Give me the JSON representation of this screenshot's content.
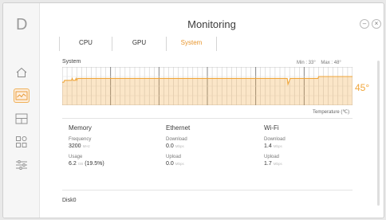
{
  "app": {
    "title": "Monitoring",
    "logo_letter": "D"
  },
  "colors": {
    "accent": "#f0a63a",
    "tab_active": "#e8962e"
  },
  "sidebar": {
    "items": [
      {
        "icon": "home-icon",
        "active": false
      },
      {
        "icon": "monitoring-icon",
        "active": true
      },
      {
        "icon": "layout-icon",
        "active": false
      },
      {
        "icon": "apps-icon",
        "active": false
      },
      {
        "icon": "settings-icon",
        "active": false
      }
    ]
  },
  "window_controls": {
    "minimize": "–",
    "close": "×"
  },
  "tabs": [
    {
      "label": "CPU",
      "active": false
    },
    {
      "label": "GPU",
      "active": false
    },
    {
      "label": "System",
      "active": true
    }
  ],
  "system": {
    "label": "System",
    "min_label": "Min : 33°",
    "max_label": "Max : 48°",
    "current_temp": "45°",
    "temp_axis_label": "Temperature (℃)"
  },
  "chart_data": {
    "type": "area",
    "series": [
      {
        "values": [
          42,
          42,
          42,
          43,
          43,
          43,
          43,
          43,
          43,
          43,
          43,
          43,
          43,
          44,
          43,
          43,
          43,
          43,
          44,
          43,
          44,
          44,
          44,
          44,
          44,
          44,
          44,
          44,
          44,
          44,
          44,
          44,
          44,
          44,
          44,
          44,
          44,
          44,
          44,
          44,
          44,
          44,
          44,
          44,
          44,
          44,
          44,
          44,
          44,
          44,
          44,
          44,
          44,
          44,
          44,
          44,
          44,
          44,
          44,
          44,
          44,
          44,
          44,
          44,
          44,
          44,
          44,
          44,
          44,
          44,
          44,
          44,
          44,
          44,
          44,
          44,
          44,
          44,
          44,
          44,
          44,
          44,
          44,
          44,
          44,
          44,
          44,
          44,
          44,
          44,
          44,
          44,
          44,
          44,
          44,
          44,
          44,
          44,
          44,
          44,
          44,
          44,
          44,
          44,
          44,
          44,
          44,
          44,
          44,
          44,
          44,
          44,
          44,
          44,
          44,
          44,
          44,
          44,
          44,
          44,
          44,
          44,
          44,
          44,
          44,
          44,
          44,
          44,
          44,
          44,
          44,
          44,
          44,
          44,
          44,
          44,
          44,
          44,
          44,
          44,
          44,
          44,
          44,
          44,
          44,
          44,
          44,
          44,
          44,
          44,
          44,
          44,
          44,
          44,
          44,
          44,
          44,
          44,
          44,
          44,
          44,
          44,
          44,
          44,
          44,
          44,
          44,
          44,
          44,
          44,
          44,
          44,
          44,
          44,
          44,
          44,
          44,
          44,
          44,
          44,
          44,
          44,
          44,
          44,
          44,
          44,
          44,
          44,
          44,
          44,
          44,
          44,
          44,
          44,
          44,
          44,
          44,
          44,
          44,
          44,
          44,
          44,
          44,
          44,
          44,
          44,
          44,
          44,
          44,
          44,
          44,
          44,
          44,
          44,
          44,
          44,
          44,
          44,
          44,
          44,
          44,
          44,
          44,
          44,
          44,
          44,
          44,
          44,
          44,
          44,
          44,
          44,
          44,
          44,
          44,
          44,
          44,
          44,
          44,
          44,
          44,
          44,
          44,
          44,
          44,
          44,
          44,
          44,
          44,
          44,
          44,
          44,
          44,
          44,
          44,
          44,
          44,
          44,
          44,
          44,
          44,
          44,
          44,
          44,
          44,
          44,
          44,
          44,
          44,
          44,
          44,
          44,
          44,
          44,
          44,
          44,
          44,
          44,
          44,
          44,
          44,
          44,
          44,
          44,
          44,
          44,
          44,
          44,
          44,
          44,
          44,
          44,
          44,
          44,
          41,
          42,
          43,
          44,
          44,
          44,
          44,
          44,
          44,
          44,
          44,
          44,
          44,
          44,
          44,
          44,
          44,
          44,
          44,
          44,
          44,
          44,
          44,
          44,
          44,
          44,
          44,
          44,
          44,
          44,
          44,
          44,
          44,
          44,
          44,
          44,
          44,
          44,
          44,
          44,
          45,
          45,
          45,
          45,
          45,
          45,
          45,
          45,
          45,
          45,
          45,
          45,
          45,
          45,
          45,
          45,
          45,
          45,
          45,
          45,
          45,
          45,
          45,
          45,
          45,
          45,
          45,
          45,
          45,
          45,
          45,
          45,
          45,
          45,
          45,
          45,
          45,
          45,
          45,
          45,
          45,
          45,
          45,
          45,
          45
        ]
      }
    ],
    "ylim": [
      30,
      50
    ],
    "grid": true,
    "ylabel": "Temperature (℃)"
  },
  "memory": {
    "title": "Memory",
    "frequency_label": "Frequency",
    "frequency_value": "3200",
    "frequency_unit": "MHz",
    "usage_label": "Usage",
    "usage_value": "6.2",
    "usage_unit": "GB",
    "usage_percent": "(19.5%)"
  },
  "ethernet": {
    "title": "Ethernet",
    "download_label": "Download",
    "download_value": "0.0",
    "download_unit": "Mbps",
    "upload_label": "Upload",
    "upload_value": "0.0",
    "upload_unit": "Mbps"
  },
  "wifi": {
    "title": "Wi-Fi",
    "download_label": "Download",
    "download_value": "1.4",
    "download_unit": "Mbps",
    "upload_label": "Upload",
    "upload_value": "1.7",
    "upload_unit": "Mbps"
  },
  "disk": {
    "title": "Disk0"
  }
}
